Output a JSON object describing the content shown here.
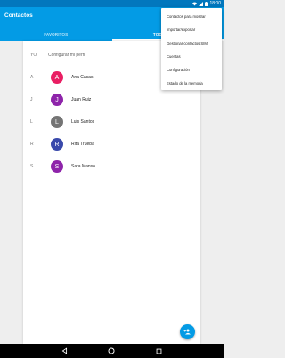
{
  "status_bar": {
    "time": "18:00"
  },
  "app_bar": {
    "title": "Contactos"
  },
  "tabs": [
    {
      "label": "FAVORITOS"
    },
    {
      "label": "TODOS LOS C"
    }
  ],
  "contacts": {
    "profile": {
      "letter": "YO",
      "label": "Configurar mi perfil"
    },
    "rows": [
      {
        "letter": "A",
        "initial": "A",
        "name": "Ana Casas",
        "color": "#e91e63"
      },
      {
        "letter": "J",
        "initial": "J",
        "name": "Juan Ruiz",
        "color": "#8e24aa"
      },
      {
        "letter": "L",
        "initial": "L",
        "name": "Luis Santos",
        "color": "#757575"
      },
      {
        "letter": "R",
        "initial": "R",
        "name": "Rita Trueba",
        "color": "#3949ab"
      },
      {
        "letter": "S",
        "initial": "S",
        "name": "Sara Manso",
        "color": "#8e24aa"
      }
    ]
  },
  "menu": {
    "items": [
      "Contactos para mostrar",
      "Importar/exportar",
      "Gestionar contactos SIM",
      "Cuentas",
      "Configuración",
      "Estado de la memoria"
    ]
  },
  "colors": {
    "primary": "#039be5",
    "status": "#0277bd"
  },
  "icons": {
    "fab": "add-person-icon",
    "nav": [
      "back-icon",
      "home-icon",
      "recents-icon"
    ]
  }
}
